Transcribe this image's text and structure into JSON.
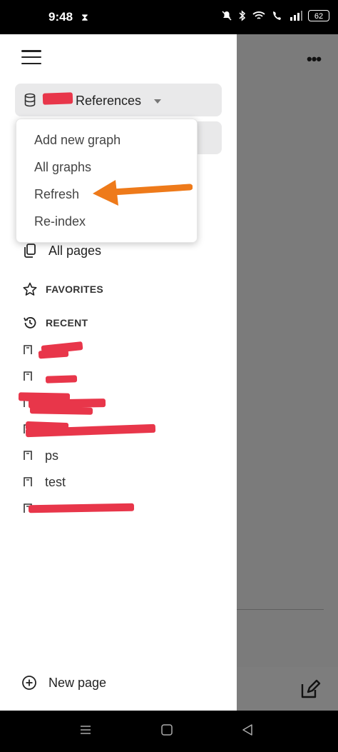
{
  "status_bar": {
    "time": "9:48",
    "battery": "62",
    "icons": [
      "hourglass-icon",
      "mute-icon",
      "bluetooth-icon",
      "wifi-icon",
      "volte-icon",
      "signal-icon",
      "battery-icon"
    ]
  },
  "graph_selector": {
    "title": "References"
  },
  "dropdown": {
    "items": [
      "Add new graph",
      "All graphs",
      "Refresh",
      "Re-index"
    ]
  },
  "nav": {
    "all_pages": "All pages",
    "favorites": "FAVORITES",
    "recent": "RECENT"
  },
  "recent_items": [
    {
      "label": ""
    },
    {
      "label": ""
    },
    {
      "label": ""
    },
    {
      "label": ""
    },
    {
      "label": "ps"
    },
    {
      "label": "test"
    },
    {
      "label": ""
    }
  ],
  "footer": {
    "new_page": "New page"
  },
  "colors": {
    "accent_arrow": "#ee7a1a",
    "redaction": "#e8364a",
    "overlay": "#7b7b7b"
  }
}
